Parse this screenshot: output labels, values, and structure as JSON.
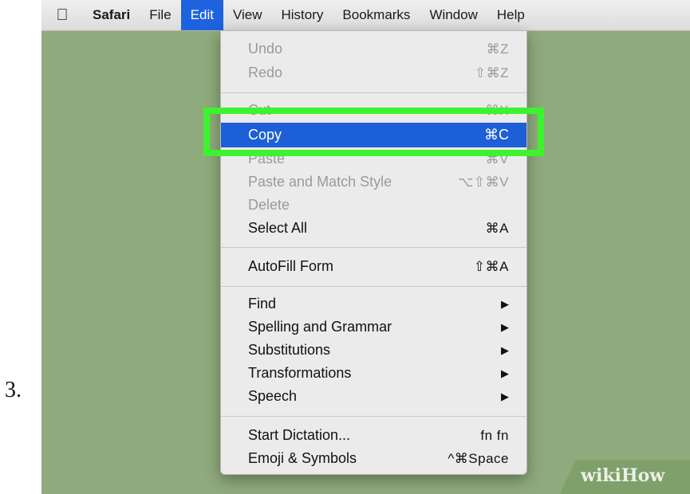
{
  "step_label": "3.",
  "menubar": {
    "apple_icon": "apple-logo-icon",
    "items": [
      "Safari",
      "File",
      "Edit",
      "View",
      "History",
      "Bookmarks",
      "Window",
      "Help"
    ]
  },
  "edit_menu": {
    "items": [
      {
        "label": "Undo",
        "shortcut": "⌘Z",
        "enabled": false
      },
      {
        "label": "Redo",
        "shortcut": "⇧⌘Z",
        "enabled": false
      },
      {
        "label": "Cut",
        "shortcut": "⌘X",
        "enabled": false
      },
      {
        "label": "Copy",
        "shortcut": "⌘C",
        "enabled": true,
        "highlighted": true
      },
      {
        "label": "Paste",
        "shortcut": "⌘V",
        "enabled": false
      },
      {
        "label": "Paste and Match Style",
        "shortcut": "⌥⇧⌘V",
        "enabled": false
      },
      {
        "label": "Delete",
        "shortcut": "",
        "enabled": false
      },
      {
        "label": "Select All",
        "shortcut": "⌘A",
        "enabled": true
      },
      {
        "label": "AutoFill Form",
        "shortcut": "⇧⌘A",
        "enabled": true
      },
      {
        "label": "Find",
        "submenu": true,
        "enabled": true
      },
      {
        "label": "Spelling and Grammar",
        "submenu": true,
        "enabled": true
      },
      {
        "label": "Substitutions",
        "submenu": true,
        "enabled": true
      },
      {
        "label": "Transformations",
        "submenu": true,
        "enabled": true
      },
      {
        "label": "Speech",
        "submenu": true,
        "enabled": true
      },
      {
        "label": "Start Dictation...",
        "shortcut": "fn fn",
        "enabled": true
      },
      {
        "label": "Emoji & Symbols",
        "shortcut": "^⌘Space",
        "enabled": true
      }
    ],
    "submenu_arrow": "▶"
  },
  "colors": {
    "desktop_bg": "#8faa7c",
    "selection_blue": "#1d5fd6",
    "highlight_green": "#3ef22e"
  },
  "watermark": "wikiHow"
}
